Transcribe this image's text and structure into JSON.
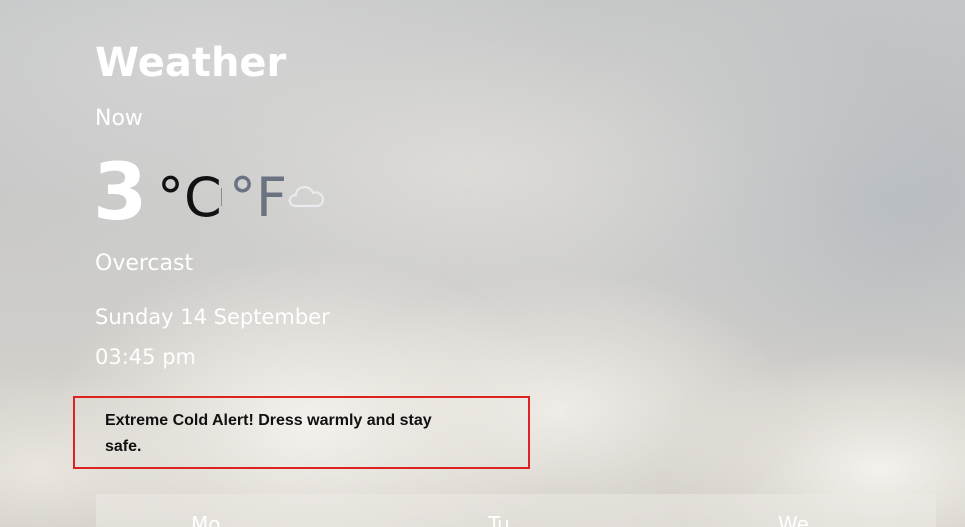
{
  "app": {
    "title": "Weather"
  },
  "current": {
    "label": "Now",
    "temperature": "3",
    "unit_celsius": "°C",
    "unit_fahrenheit": "°F",
    "selected_unit": "celsius",
    "condition": "Overcast",
    "condition_icon": "cloud-icon",
    "date": "Sunday 14 September",
    "time": "03:45 pm"
  },
  "alert": {
    "text": "Extreme Cold Alert! Dress warmly and stay safe.",
    "border_color": "#dd2222"
  },
  "forecast": {
    "days": [
      {
        "label": "Mo"
      },
      {
        "label": "Tu"
      },
      {
        "label": "We"
      }
    ]
  },
  "colors": {
    "selected_unit": "#111111",
    "unselected_unit": "#6b7280",
    "text": "#ffffff"
  }
}
